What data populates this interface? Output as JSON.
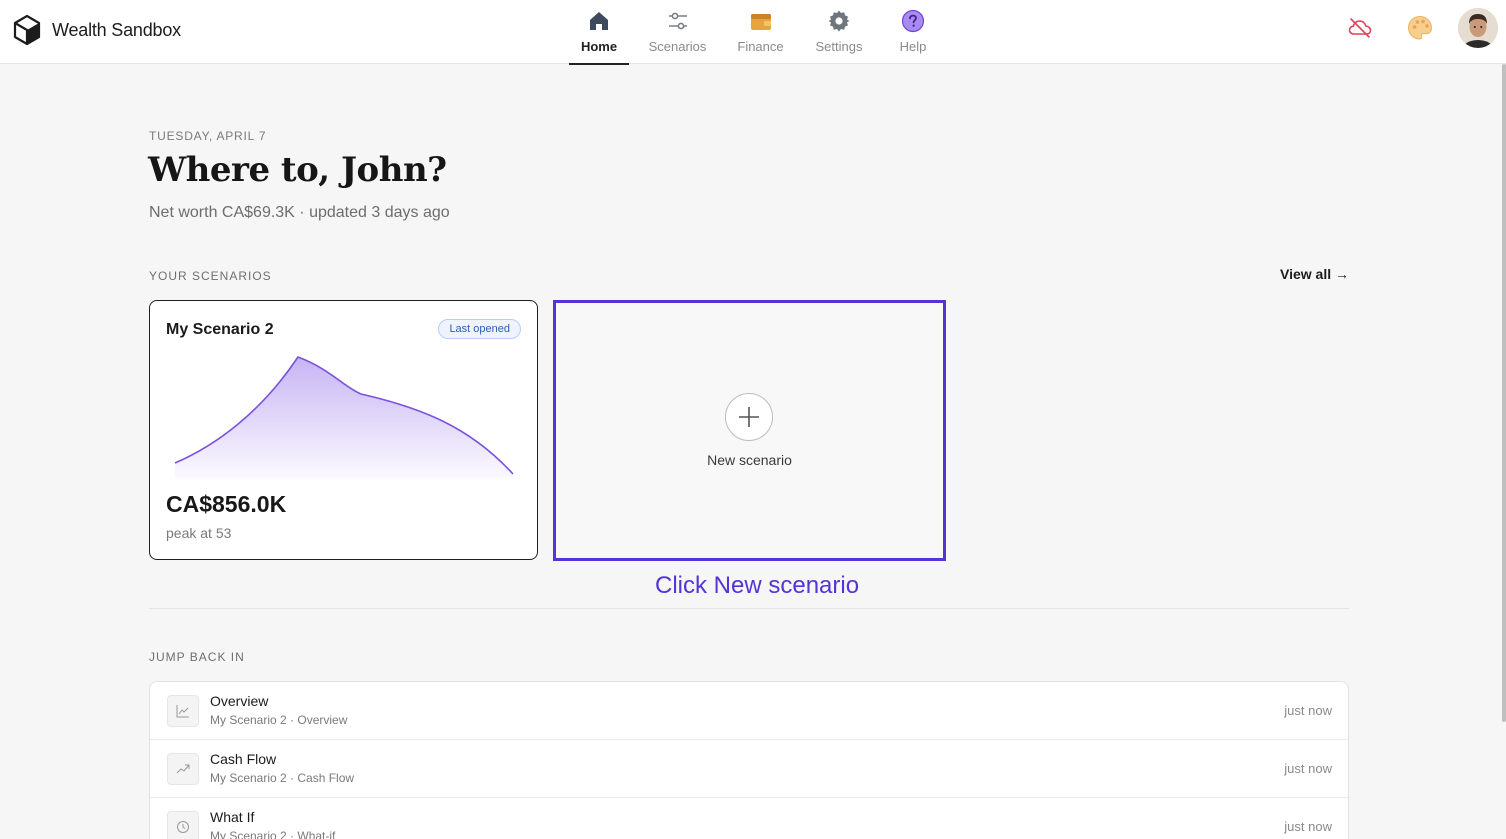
{
  "app": {
    "name": "Wealth Sandbox"
  },
  "nav": {
    "items": [
      {
        "label": "Home",
        "icon": "home-icon",
        "active": true
      },
      {
        "label": "Scenarios",
        "icon": "sliders-icon",
        "active": false
      },
      {
        "label": "Finance",
        "icon": "wallet-icon",
        "active": false
      },
      {
        "label": "Settings",
        "icon": "gear-icon",
        "active": false
      },
      {
        "label": "Help",
        "icon": "help-icon",
        "active": false
      }
    ]
  },
  "header_actions": {
    "sync_icon": "cloud-off-icon",
    "theme_icon": "palette-icon",
    "avatar_icon": "user-avatar"
  },
  "hero": {
    "date": "TUESDAY, APRIL 7",
    "greeting": "Where to, John?",
    "networth": "Net worth CA$69.3K · updated 3 days ago"
  },
  "scenarios": {
    "section_label": "YOUR SCENARIOS",
    "view_all": "View all →",
    "card": {
      "title": "My Scenario 2",
      "badge": "Last opened",
      "value": "CA$856.0K",
      "sub": "peak at 53"
    },
    "new": {
      "label": "New scenario"
    },
    "callout": "Click New scenario"
  },
  "jump": {
    "section_label": "JUMP BACK IN",
    "items": [
      {
        "title": "Overview",
        "sub": "My Scenario 2 · Overview",
        "time": "just now",
        "icon": "line-chart-icon"
      },
      {
        "title": "Cash Flow",
        "sub": "My Scenario 2 · Cash Flow",
        "time": "just now",
        "icon": "trend-icon"
      },
      {
        "title": "What If",
        "sub": "My Scenario 2 · What-if",
        "time": "just now",
        "icon": "clock-icon"
      }
    ]
  },
  "colors": {
    "accent": "#5533d6",
    "chart_fill": "#c9b8f5",
    "chart_line": "#7a52dc"
  }
}
